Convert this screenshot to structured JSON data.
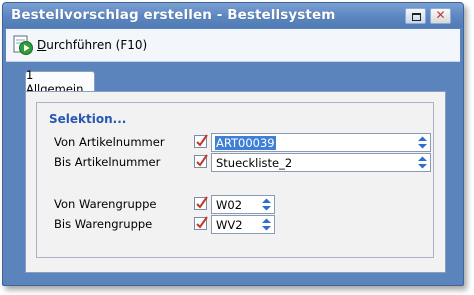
{
  "window": {
    "title": "Bestellvorschlag erstellen - Bestellsystem"
  },
  "toolbar": {
    "execute_label_accel": "D",
    "execute_label_rest": "urchführen (F10)",
    "execute_icon": "play-document-icon"
  },
  "tabs": [
    {
      "label": "1 Allgemein",
      "active": true
    }
  ],
  "selection": {
    "group_title": "Selektion...",
    "fields": [
      {
        "label": "Von Artikelnummer",
        "value": "ART00039",
        "checked": true,
        "selected_text": true
      },
      {
        "label": "Bis Artikelnummer",
        "value": "Stueckliste_2",
        "checked": true
      },
      {
        "label": "Von Warengruppe",
        "value": "W02",
        "checked": true
      },
      {
        "label": "Bis Warengruppe",
        "value": "WV2",
        "checked": true
      }
    ]
  },
  "colors": {
    "accent": "#2a57b3",
    "titlebar": "#5c86c0",
    "selection": "#3f7fd6",
    "check": "#c0392b"
  }
}
